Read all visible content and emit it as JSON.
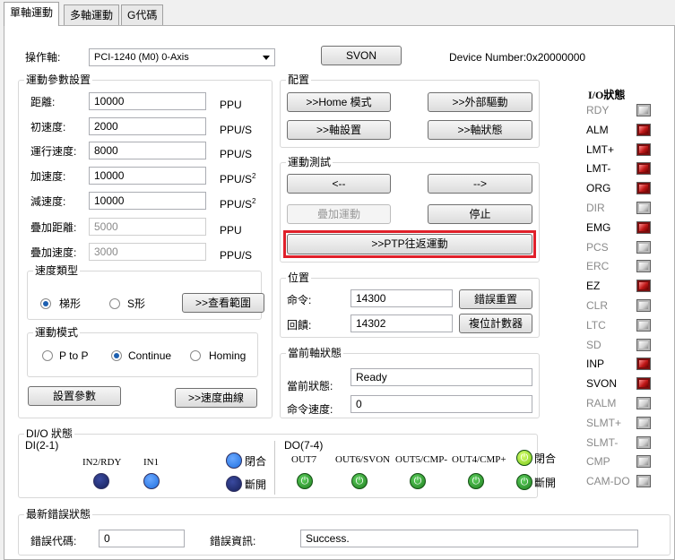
{
  "tabs": [
    "單軸運動",
    "多軸運動",
    "G代碼"
  ],
  "header": {
    "axis_label": "操作軸:",
    "axis_value": "PCI-1240 (M0) 0-Axis",
    "svon_button": "SVON",
    "device_number": "Device Number:0x20000000"
  },
  "motion_params": {
    "title": "運動參數設置",
    "rows": [
      {
        "label": "距離:",
        "value": "10000",
        "unit": "PPU",
        "unit_sup": "",
        "disabled": false
      },
      {
        "label": "初速度:",
        "value": "2000",
        "unit": "PPU/S",
        "unit_sup": "",
        "disabled": false
      },
      {
        "label": "運行速度:",
        "value": "8000",
        "unit": "PPU/S",
        "unit_sup": "",
        "disabled": false
      },
      {
        "label": "加速度:",
        "value": "10000",
        "unit": "PPU/S",
        "unit_sup": "2",
        "disabled": false
      },
      {
        "label": "減速度:",
        "value": "10000",
        "unit": "PPU/S",
        "unit_sup": "2",
        "disabled": false
      },
      {
        "label": "疊加距離:",
        "value": "5000",
        "unit": "PPU",
        "unit_sup": "",
        "disabled": true
      },
      {
        "label": "疊加速度:",
        "value": "3000",
        "unit": "PPU/S",
        "unit_sup": "",
        "disabled": true
      }
    ]
  },
  "speed_type": {
    "title": "速度類型",
    "options": [
      "梯形",
      "S形"
    ],
    "selected": "梯形",
    "check_range_button": ">>查看範圍"
  },
  "motion_mode": {
    "title": "運動模式",
    "options": [
      "P to P",
      "Continue",
      "Homing"
    ],
    "selected": "Continue"
  },
  "param_buttons": {
    "set_params": "設置參數",
    "speed_curve": ">>速度曲線"
  },
  "config": {
    "title": "配置",
    "home_mode": ">>Home 模式",
    "external_drive": ">>外部驅動",
    "axis_setup": ">>軸設置",
    "axis_status": ">>軸狀態"
  },
  "motion_test": {
    "title": "運動測試",
    "left": "<--",
    "right": "-->",
    "overlay": "疊加運動",
    "stop": "停止",
    "ptp": ">>PTP往返運動"
  },
  "position": {
    "title": "位置",
    "command_label": "命令:",
    "command_value": "14300",
    "feedback_label": "回饋:",
    "feedback_value": "14302",
    "reset_error": "錯誤重置",
    "reset_counter": "複位計數器"
  },
  "axis_state": {
    "title": "當前軸狀態",
    "state_label": "當前狀態:",
    "state_value": "Ready",
    "speed_label": "命令速度:",
    "speed_value": "0"
  },
  "io_status": {
    "title": "I/O狀態",
    "items": [
      {
        "name": "RDY",
        "active": false
      },
      {
        "name": "ALM",
        "active": true
      },
      {
        "name": "LMT+",
        "active": true
      },
      {
        "name": "LMT-",
        "active": true
      },
      {
        "name": "ORG",
        "active": true
      },
      {
        "name": "DIR",
        "active": false
      },
      {
        "name": "EMG",
        "active": true
      },
      {
        "name": "PCS",
        "active": false
      },
      {
        "name": "ERC",
        "active": false
      },
      {
        "name": "EZ",
        "active": true
      },
      {
        "name": "CLR",
        "active": false
      },
      {
        "name": "LTC",
        "active": false
      },
      {
        "name": "SD",
        "active": false
      },
      {
        "name": "INP",
        "active": true
      },
      {
        "name": "SVON",
        "active": true
      },
      {
        "name": "RALM",
        "active": false
      },
      {
        "name": "SLMT+",
        "active": false
      },
      {
        "name": "SLMT-",
        "active": false
      },
      {
        "name": "CMP",
        "active": false
      },
      {
        "name": "CAM-DO",
        "active": false
      }
    ]
  },
  "dio": {
    "title": "DI/O 狀態",
    "di_title": "DI(2-1)",
    "di_items": [
      "IN2/RDY",
      "IN1"
    ],
    "di_closed": "閉合",
    "di_open": "斷開",
    "do_title": "DO(7-4)",
    "do_items": [
      "OUT7",
      "OUT6/SVON",
      "OUT5/CMP-",
      "OUT4/CMP+"
    ],
    "do_closed": "閉合",
    "do_open": "斷開"
  },
  "last_error": {
    "title": "最新錯誤狀態",
    "code_label": "錯誤代碼:",
    "code_value": "0",
    "info_label": "錯誤資訊:",
    "info_value": "Success."
  },
  "colors": {
    "highlight": "#e0202a",
    "led_blue": "#1f6fe0",
    "led_dark": "#17215a",
    "io_red": "#c01818"
  }
}
